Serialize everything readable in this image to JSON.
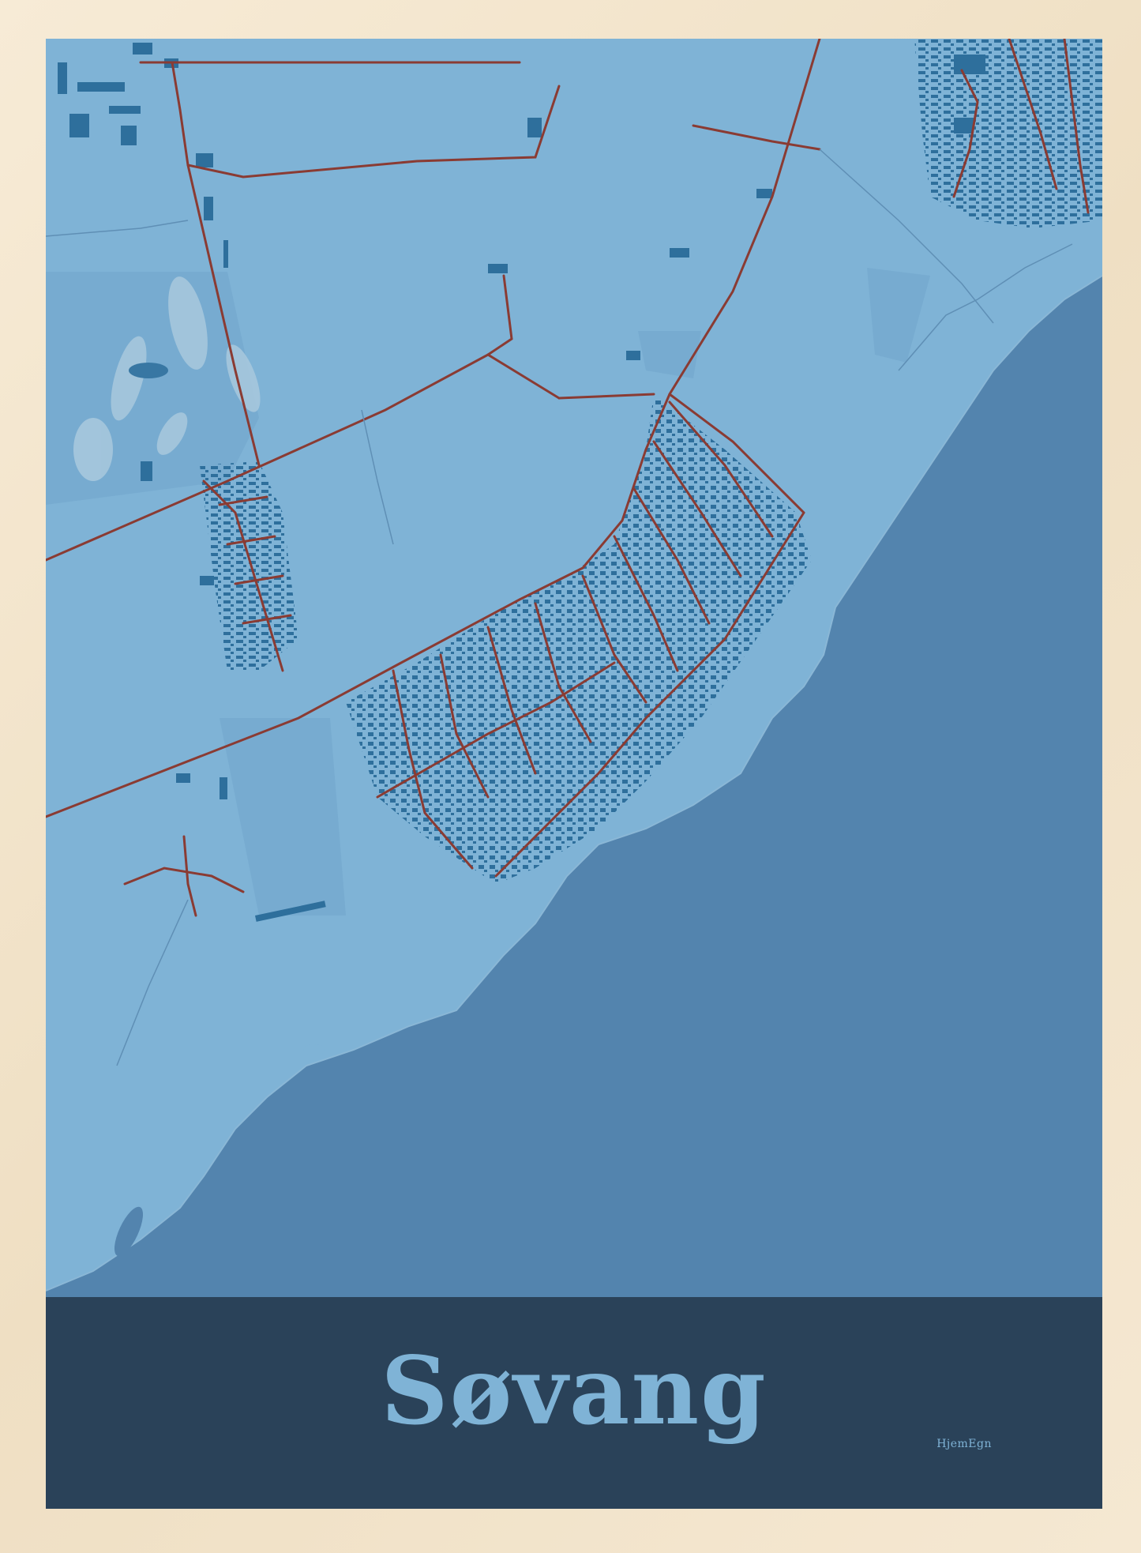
{
  "poster": {
    "city_name": "Søvang",
    "brand": "HjemEgn"
  },
  "colors": {
    "frame": "#f3e6cf",
    "land": "#7fb3d6",
    "land_dark": "#6fa3c9",
    "water": "#5384ae",
    "buildings": "#2e6f9c",
    "roads": "#8a3b33",
    "banner": "#2a4259",
    "title": "#7fb3d6"
  },
  "map": {
    "features": [
      "coastline",
      "sea",
      "roads",
      "buildings",
      "fields",
      "golf-course"
    ]
  }
}
